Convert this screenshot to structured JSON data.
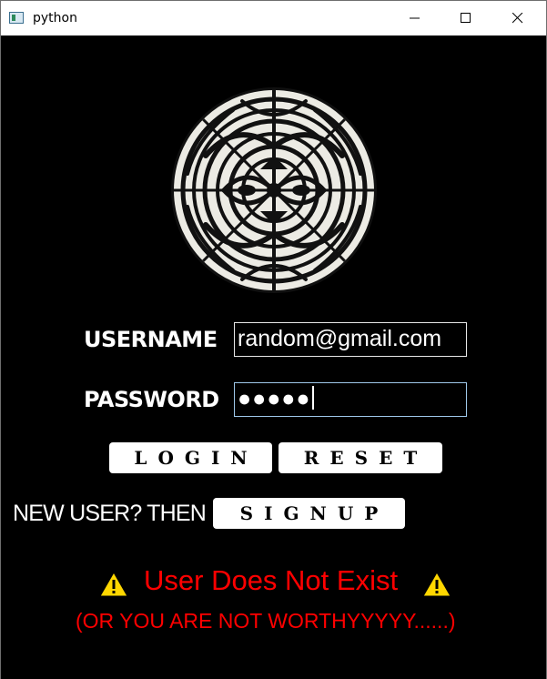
{
  "window": {
    "title": "python",
    "icons": [
      "app-icon",
      "minimize-icon",
      "maximize-icon",
      "close-icon"
    ]
  },
  "form": {
    "username_label": "USERNAME",
    "username_value": "random@gmail.com",
    "password_label": "PASSWORD",
    "password_value": "●●●●●"
  },
  "buttons": {
    "login": "LOGIN",
    "reset": "RESET",
    "signup": "SIGNUP"
  },
  "signup_prompt": "NEW USER? THEN",
  "error": {
    "title": "User Does Not Exist",
    "subtitle": "(OR YOU ARE NOT WORTHYYYYY......)",
    "icon": "warning-icon",
    "color": "#ff0000"
  },
  "logo": {
    "icon": "tribal-emblem-icon"
  }
}
